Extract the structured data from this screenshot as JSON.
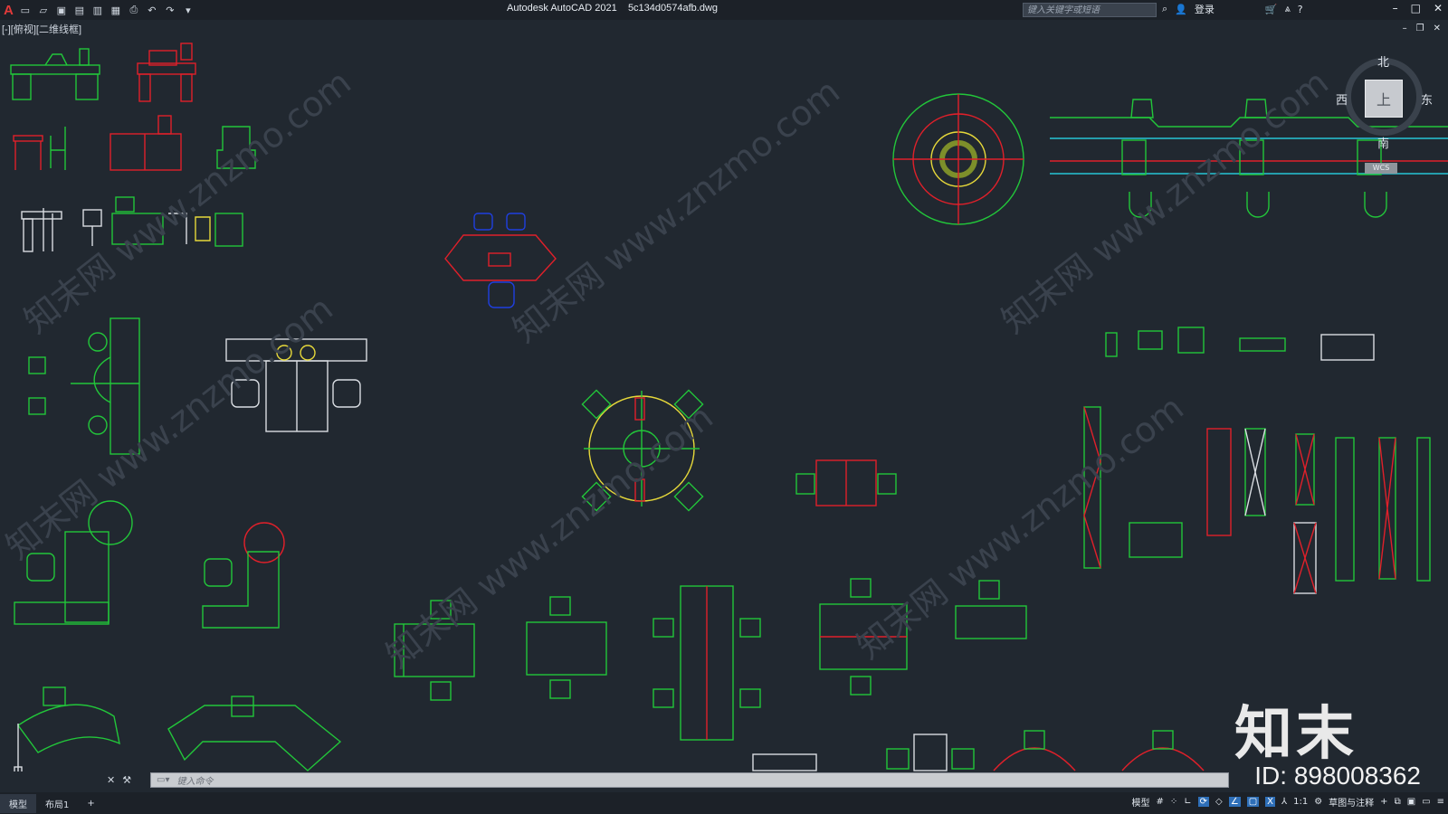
{
  "app": {
    "logo": "A",
    "title": "Autodesk AutoCAD 2021",
    "filename": "5c134d0574afb.dwg"
  },
  "quick_access": {
    "icons": [
      "new-icon",
      "open-icon",
      "save-icon",
      "saveas-icon",
      "plot-preview-icon",
      "publish-icon",
      "print-icon",
      "undo-icon",
      "redo-icon",
      "customize-icon"
    ]
  },
  "search": {
    "placeholder": "键入关键字或短语"
  },
  "account": {
    "login": "登录"
  },
  "window_controls": {
    "minimize": "–",
    "maximize": "□",
    "close": "✕"
  },
  "viewport": {
    "label": "[-][俯视][二维线框]"
  },
  "viewcube": {
    "north": "北",
    "south": "南",
    "east": "东",
    "west": "西",
    "top": "上",
    "wcs": "WCS"
  },
  "command": {
    "placeholder": "键入命令"
  },
  "layout_tabs": [
    {
      "label": "模型"
    },
    {
      "label": "布局1"
    },
    {
      "label": "+"
    }
  ],
  "status": {
    "model": "模型",
    "scale": "1:1",
    "workspace": "草图与注释"
  },
  "watermark": {
    "brand": "知末",
    "id": "ID: 898008362",
    "site": "知末网 www.znzmo.com"
  },
  "colors": {
    "background": "#212830",
    "green": "#22c63a",
    "red": "#e0202a",
    "blue": "#1f3fe0",
    "yellow": "#e6d83a",
    "cyan": "#27c6d6",
    "white": "#d9dde2"
  }
}
